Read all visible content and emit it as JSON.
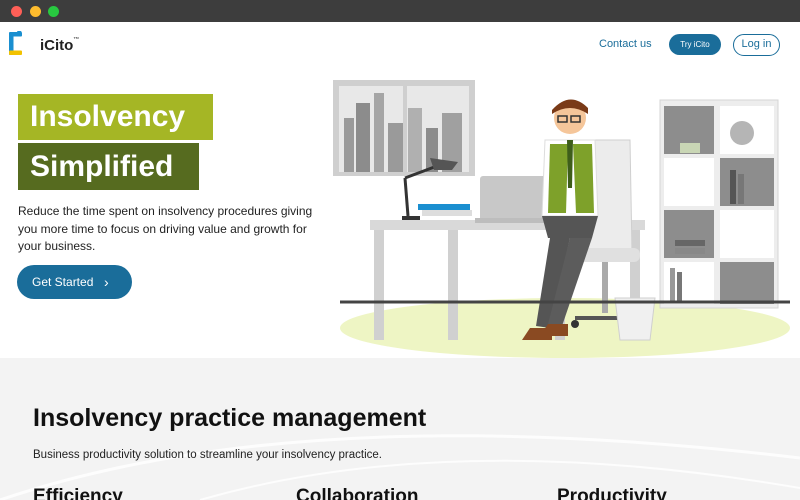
{
  "window": {
    "controls": [
      "close",
      "minimize",
      "maximize"
    ]
  },
  "header": {
    "logo_text": "iCito",
    "logo_tm": "™",
    "logo_icon": "icito-logo-icon",
    "nav_contact": "Contact us",
    "try_label": "Try iCito",
    "login_label": "Log in"
  },
  "hero": {
    "title_line1": "Insolvency",
    "title_line2": "Simplified",
    "description": "Reduce the time spent on insolvency procedures giving you more time to focus on driving value and growth for your business.",
    "cta_label": "Get Started",
    "cta_icon": "chevron-right-icon"
  },
  "section": {
    "title": "Insolvency practice management",
    "subtitle": "Business productivity solution to streamline your insolvency practice.",
    "features": [
      "Efficiency",
      "Collaboration",
      "Productivity"
    ]
  },
  "colors": {
    "brand_blue": "#1a6d9a",
    "title_green_light": "#a5b625",
    "title_green_dark": "#566b1f",
    "logo_blue": "#1a8fd0",
    "logo_yellow": "#f2c200"
  }
}
